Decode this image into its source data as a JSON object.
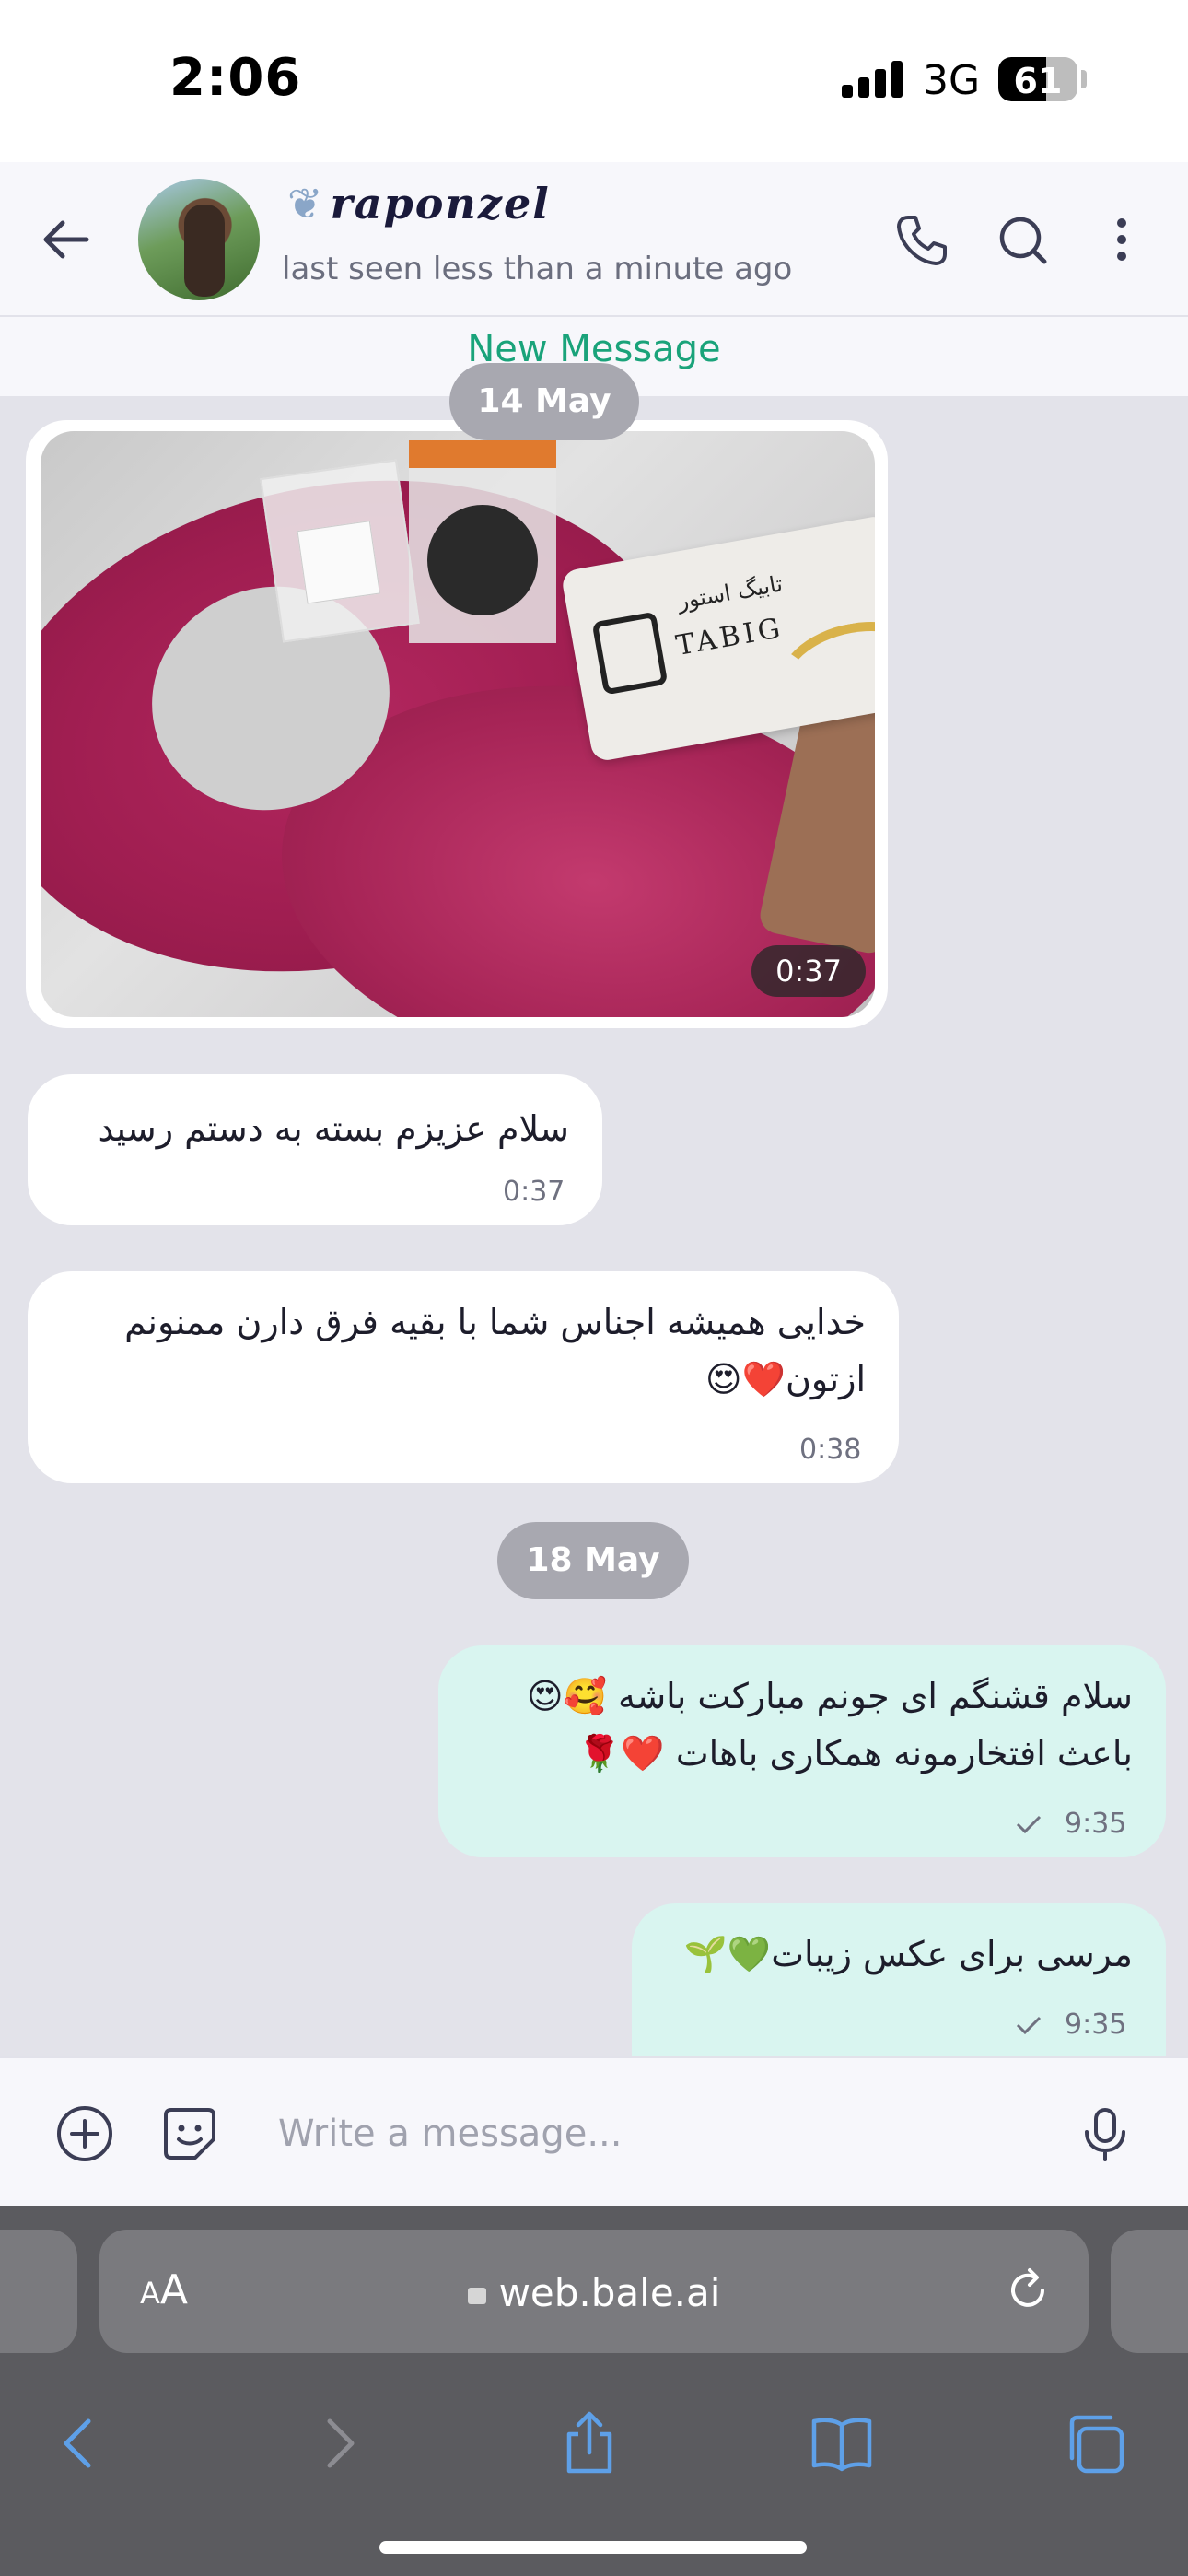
{
  "status_bar": {
    "time": "2:06",
    "network": "3G",
    "battery": "61",
    "battery_fraction": 0.61
  },
  "header": {
    "contact_name": "raponzel",
    "last_seen": "last seen less than a minute ago",
    "icons": [
      "back-arrow-icon",
      "phone-icon",
      "search-icon",
      "more-vertical-icon"
    ]
  },
  "new_message_label": "New Message",
  "dates": [
    "14 May",
    "18 May"
  ],
  "media": {
    "duration": "0:37",
    "card_brand": "TABIG",
    "card_brand_fa": "تابیگ استور"
  },
  "messages": [
    {
      "direction": "in",
      "lines": [
        "سلام عزیزم بسته به دستم رسید"
      ],
      "time": "0:37"
    },
    {
      "direction": "in",
      "lines": [
        "خدایی همیشه اجناس شما با بقیه فرق دارن ممنونم",
        "ازتون❤️😍"
      ],
      "time": "0:38"
    },
    {
      "direction": "out",
      "lines": [
        "سلام قشنگم ای جونم مبارکت باشه 🥰😍",
        "باعث افتخارمونه همکاری باهات ❤️🌹"
      ],
      "time": "9:35",
      "status": "sent"
    },
    {
      "direction": "out",
      "lines": [
        "مرسی برای عکس زیبات💚🌱"
      ],
      "time": "9:35",
      "status": "sent"
    }
  ],
  "composer": {
    "placeholder": "Write a message...",
    "icons": [
      "add-circle-icon",
      "sticker-icon",
      "microphone-icon"
    ]
  },
  "browser": {
    "text_size_label": "AA",
    "url": "web.bale.ai",
    "nav": [
      "back-icon",
      "forward-icon",
      "share-icon",
      "bookmarks-icon",
      "tabs-icon"
    ]
  },
  "colors": {
    "accent_green": "#1aa37a",
    "outgoing_bubble": "#d9f5f0",
    "incoming_bubble": "#ffffff",
    "chat_background": "#e3e3ea",
    "icon_blue": "#5ea0e8"
  }
}
